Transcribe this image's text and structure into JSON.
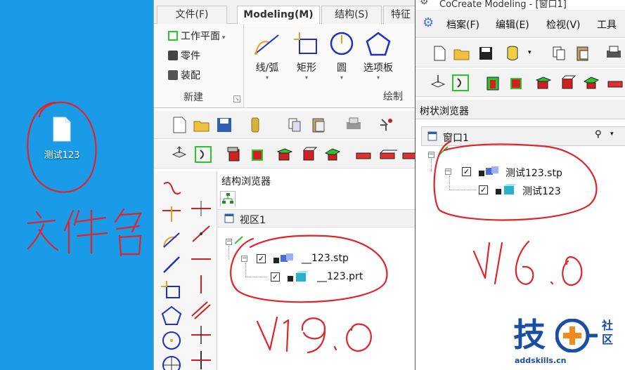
{
  "desktop": {
    "file_label": "测试123",
    "annotation_text": "文件名"
  },
  "v19": {
    "tabs": [
      "文件(F)",
      "Modeling(M)",
      "结构(S)",
      "特征"
    ],
    "active_tab": "Modeling(M)",
    "new_group": {
      "items": [
        "工作平面",
        "零件",
        "装配"
      ],
      "label": "新建"
    },
    "draw_group": {
      "items": [
        "线/弧",
        "矩形",
        "圆",
        "选项板"
      ],
      "label": "绘制"
    },
    "browser": {
      "title": "结构浏览器",
      "view_label": "视区1",
      "nodes": [
        "__123.stp",
        "__123.prt"
      ]
    },
    "annotation_text": "V19.0"
  },
  "v16": {
    "title": "CoCreate Modeling - [窗口1]",
    "menus": [
      "档案(F)",
      "编辑(E)",
      "检视(V)",
      "工具"
    ],
    "browser": {
      "title": "树状浏览器",
      "window_label": "窗口1",
      "nodes": [
        "测试123.stp",
        "测试123"
      ]
    },
    "annotation_text": "V16.0"
  },
  "watermark": {
    "name": "技",
    "small": "社区",
    "url": "addskills.cn"
  },
  "colors": {
    "desktop": "#1a9be8",
    "annotation_red": "#e0242a",
    "logo_blue": "#1a4ea0",
    "logo_orange": "#f08a1c",
    "accent_green": "#2dc52d"
  }
}
